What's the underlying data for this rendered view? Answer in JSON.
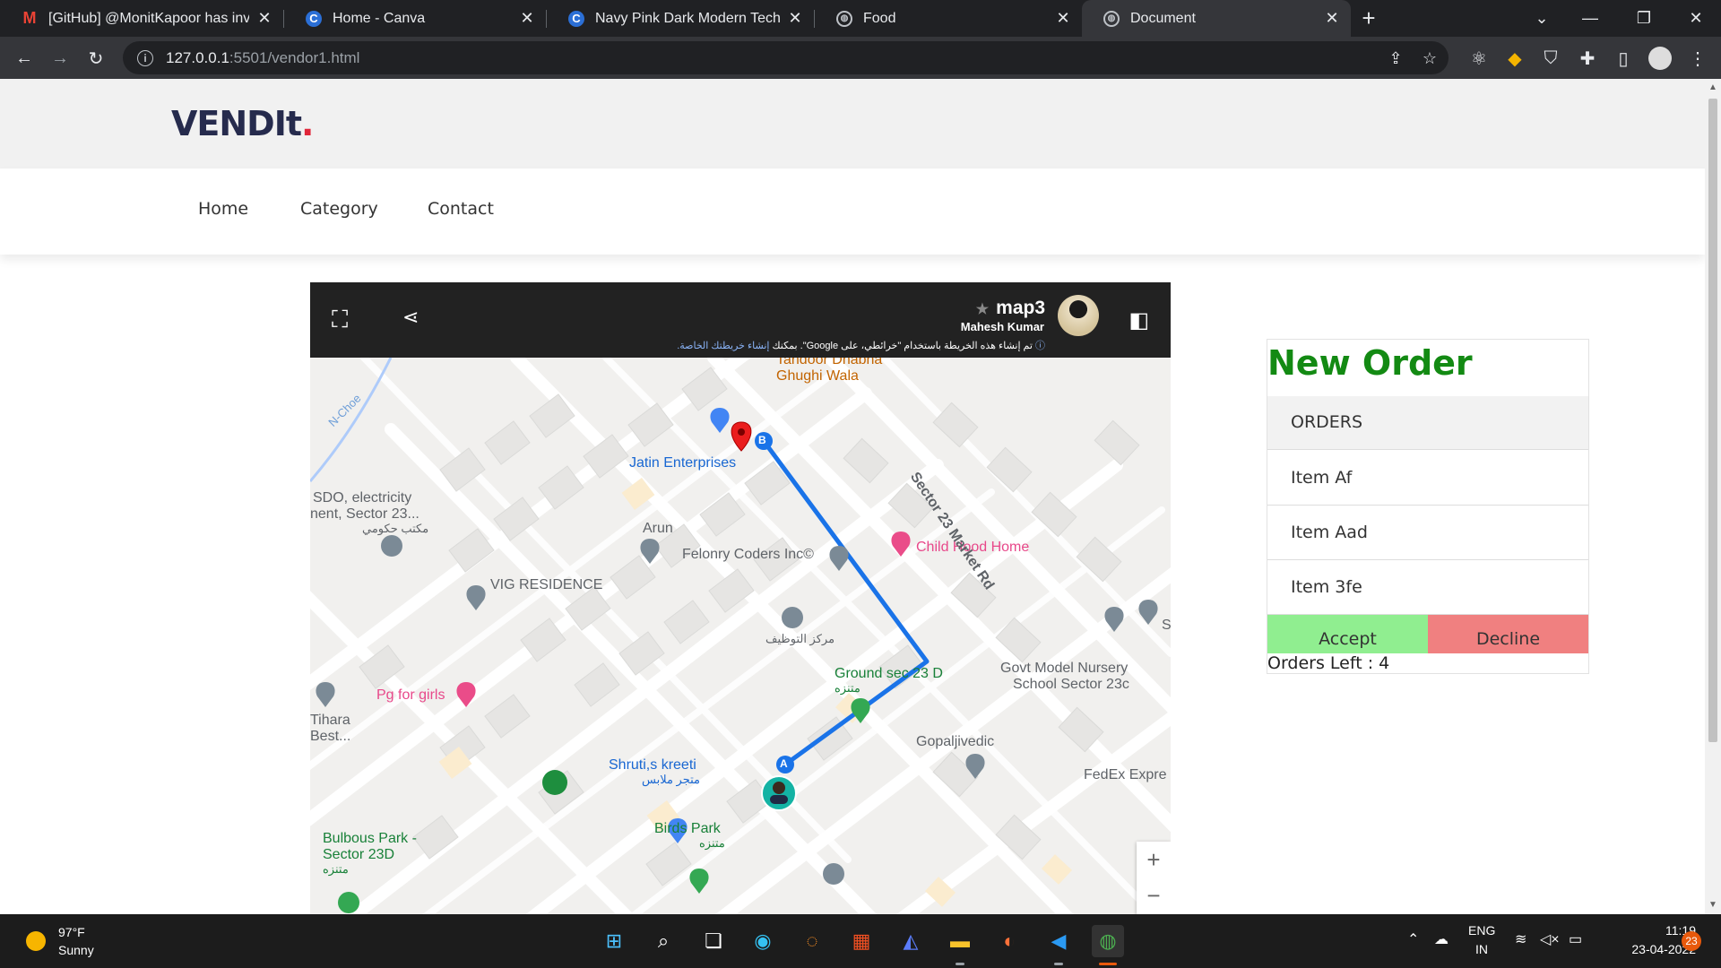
{
  "browser": {
    "tabs": [
      {
        "title": "[GitHub] @MonitKapoor has invi",
        "icon": "gmail-icon"
      },
      {
        "title": "Home - Canva",
        "icon": "canva-icon"
      },
      {
        "title": "Navy Pink Dark Modern Technolo",
        "icon": "canva-icon"
      },
      {
        "title": "Food",
        "icon": "globe-icon"
      },
      {
        "title": "Document",
        "icon": "globe-icon"
      }
    ],
    "active_tab": 4,
    "url_host": "127.0.0.1",
    "url_rest": ":5501/vendor1.html"
  },
  "site": {
    "logo": "VENDIt",
    "logo_dot": ".",
    "nav": [
      "Home",
      "Category",
      "Contact"
    ]
  },
  "map": {
    "title": "map3",
    "author": "Mahesh Kumar",
    "note": "تم إنشاء هذه الخريطة باستخدام \"خرائطي، على Google\". بمكنك",
    "note_link": "إنشاء خريطتك الخاصة.",
    "labels": {
      "tandoor": "Tandoor Dhabha",
      "ghughi": "Ghughi Wala",
      "jatin": "Jatin Enterprises",
      "sdo1": "SDO, electricity",
      "sdo2": "nent, Sector 23...",
      "sdo3": "مكتب حكومي",
      "arun": "Arun",
      "felonry": "Felonry Coders Inc©",
      "childhood": "Child Hood Home",
      "vig": "VIG RESIDENCE",
      "sector23": "Sector 23 Market Rd",
      "markaz": "مركز التوظيف",
      "pg": "Pg for girls",
      "ground1": "Ground sec 23 D",
      "ground2": "متنزه",
      "govt1": "Govt Model Nursery",
      "govt2": "School Sector 23c",
      "tihara1": "Tihara",
      "tihara2": "Best...",
      "shruti1": "Shruti,s kreeti",
      "shruti2": "متجر ملابس",
      "gopal": "Gopaljivedic",
      "fedex": "FedEx Expre",
      "birds1": "Birds Park",
      "birds2": "متنزه",
      "bulbous1": "Bulbous Park -",
      "bulbous2": "Sector 23D",
      "bulbous3": "متنزه",
      "nchoe": "N-Choe",
      "edge_s": "S",
      "marker_a": "A",
      "marker_b": "B"
    },
    "zoom_in": "+",
    "zoom_out": "−"
  },
  "order": {
    "title": "New Order",
    "header": "ORDERS",
    "items": [
      "Item Af",
      "Item Aad",
      "Item 3fe"
    ],
    "accept": "Accept",
    "decline": "Decline",
    "orders_left": "Orders Left : 4"
  },
  "taskbar": {
    "temp": "97°F",
    "condition": "Sunny",
    "lang1": "ENG",
    "lang2": "IN",
    "time": "11:19",
    "date": "23-04-2022",
    "notifications": "23"
  }
}
